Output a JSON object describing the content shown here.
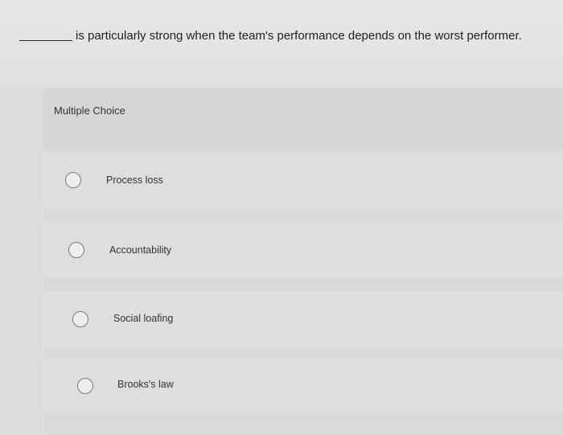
{
  "question": {
    "blank": "________",
    "text": "is particularly strong when the team's performance depends on the worst performer."
  },
  "quiz": {
    "type_label": "Multiple Choice",
    "options": [
      {
        "label": "Process loss",
        "selected": false
      },
      {
        "label": "Accountability",
        "selected": false
      },
      {
        "label": "Social loafing",
        "selected": false
      },
      {
        "label": "Brooks's law",
        "selected": false
      }
    ]
  }
}
